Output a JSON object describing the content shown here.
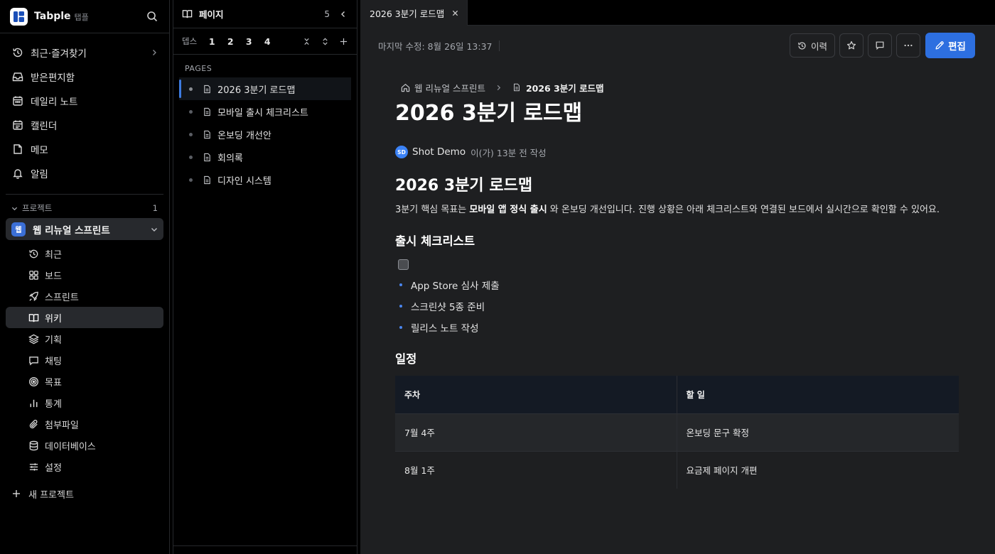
{
  "app": {
    "name": "Tabple",
    "name_sub": "탭플"
  },
  "sidebar": {
    "nav": [
      {
        "label": "최근·즐겨찾기",
        "icon": "history-icon"
      },
      {
        "label": "받은편지함",
        "icon": "inbox-icon"
      },
      {
        "label": "데일리 노트",
        "icon": "calendar-icon"
      },
      {
        "label": "캘린더",
        "icon": "calendar-grid-icon"
      },
      {
        "label": "메모",
        "icon": "memo-icon"
      },
      {
        "label": "알림",
        "icon": "bell-icon"
      }
    ],
    "projects_label": "프로젝트",
    "projects_count": "1",
    "project": {
      "badge": "웹",
      "name": "웹 리뉴얼 스프린트"
    },
    "project_items": [
      {
        "label": "최근",
        "icon": "history-icon"
      },
      {
        "label": "보드",
        "icon": "board-icon"
      },
      {
        "label": "스프린트",
        "icon": "rocket-icon"
      },
      {
        "label": "위키",
        "icon": "book-icon",
        "active": true
      },
      {
        "label": "기획",
        "icon": "layers-icon"
      },
      {
        "label": "채팅",
        "icon": "chat-icon"
      },
      {
        "label": "목표",
        "icon": "target-icon"
      },
      {
        "label": "통계",
        "icon": "chart-icon"
      },
      {
        "label": "첨부파일",
        "icon": "paperclip-icon"
      },
      {
        "label": "데이터베이스",
        "icon": "database-icon"
      },
      {
        "label": "설정",
        "icon": "sliders-icon"
      }
    ],
    "new_project": "새 프로젝트"
  },
  "pages_panel": {
    "title": "페이지",
    "count": "5",
    "depth_label": "뎁스",
    "depth_levels": [
      "1",
      "2",
      "3",
      "4"
    ],
    "section_label": "PAGES",
    "pages": [
      {
        "title": "2026 3분기 로드맵",
        "active": true
      },
      {
        "title": "모바일 출시 체크리스트"
      },
      {
        "title": "온보딩 개선안"
      },
      {
        "title": "회의록"
      },
      {
        "title": "디자인 시스템"
      }
    ]
  },
  "tab": {
    "title": "2026 3분기 로드맵"
  },
  "toolbar": {
    "last_edit": "마지막 수정: 8월 26일 13:37",
    "history_label": "이력",
    "edit_label": "편집"
  },
  "doc": {
    "breadcrumb_parent": "웹 리뉴얼 스프린트",
    "breadcrumb_current": "2026 3분기 로드맵",
    "title": "2026 3분기 로드맵",
    "author_initials": "SD",
    "author_name": "Shot Demo",
    "author_meta": "이(가) 13분 전 작성",
    "heading": "2026 3분기 로드맵",
    "para_before": "3분기 핵심 목표는 ",
    "para_bold": "모바일 앱 정식 출시",
    "para_after": " 와 온보딩 개선입니다. 진행 상황은 아래 체크리스트와 연결된 보드에서 실시간으로 확인할 수 있어요.",
    "checklist_heading": "출시 체크리스트",
    "checklist": [
      "App Store 심사 제출",
      "스크린샷 5종 준비",
      "릴리스 노트 작성"
    ],
    "schedule_heading": "일정",
    "table": {
      "headers": [
        "주차",
        "할 일"
      ],
      "rows": [
        [
          "7월 4주",
          "온보딩 문구 확정"
        ],
        [
          "8월 1주",
          "요금제 페이지 개편"
        ]
      ]
    }
  },
  "colors": {
    "accent": "#2d6fe0",
    "badge": "#3b6fd6",
    "avatar": "#3b82f6"
  }
}
